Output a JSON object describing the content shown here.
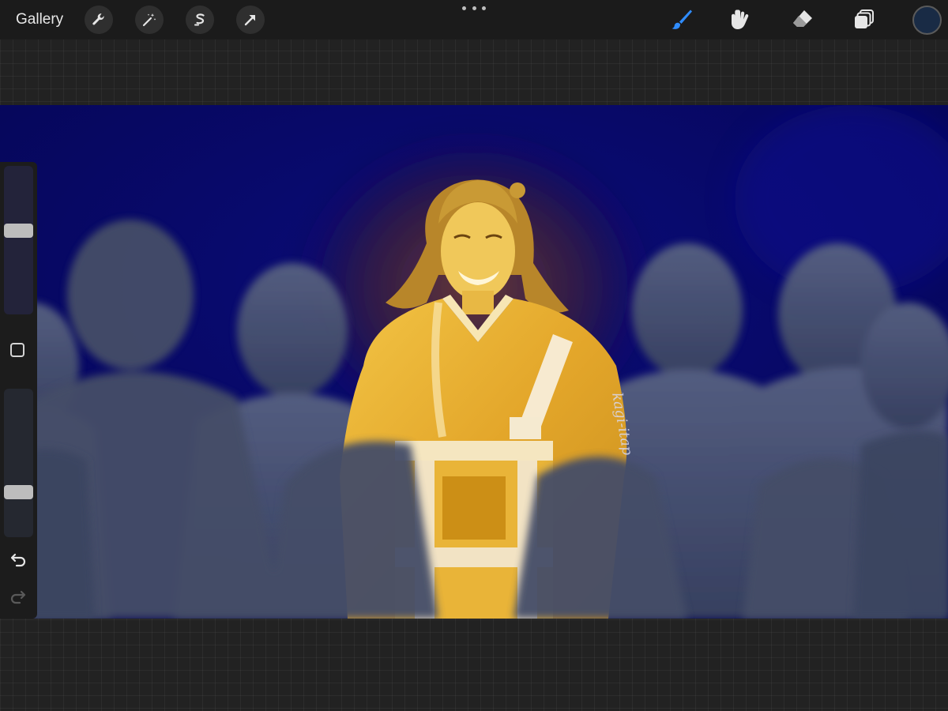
{
  "app": {
    "gallery_label": "Gallery"
  },
  "toolbar": {
    "left_actions": [
      "wrench-icon",
      "magic-wand-icon",
      "selection-icon",
      "transform-icon"
    ],
    "more_menu_icon": "more-dots-icon",
    "right_tools": [
      "brush-icon",
      "smudge-icon",
      "eraser-icon",
      "layers-icon"
    ],
    "active_tool": "brush-icon",
    "active_color": "#192b45"
  },
  "sidebar": {
    "size_slider_level": 0.57,
    "opacity_slider_level": 0.28,
    "modify_button_icon": "modify-square-icon",
    "undo_icon": "undo-icon",
    "redo_icon": "redo-icon"
  },
  "canvas": {
    "artwork": "painting-of-smiling-figure-in-robes-amid-silhouette-crowd",
    "signature": "kagi-itap",
    "background_color": "#07086a",
    "figure_color": "#e8b232",
    "crowd_color": "#4c5670"
  },
  "colors": {
    "toolbar_bg": "#1b1b1b",
    "accent_blue": "#2f8cff",
    "icon_light": "#e6e6e6"
  }
}
